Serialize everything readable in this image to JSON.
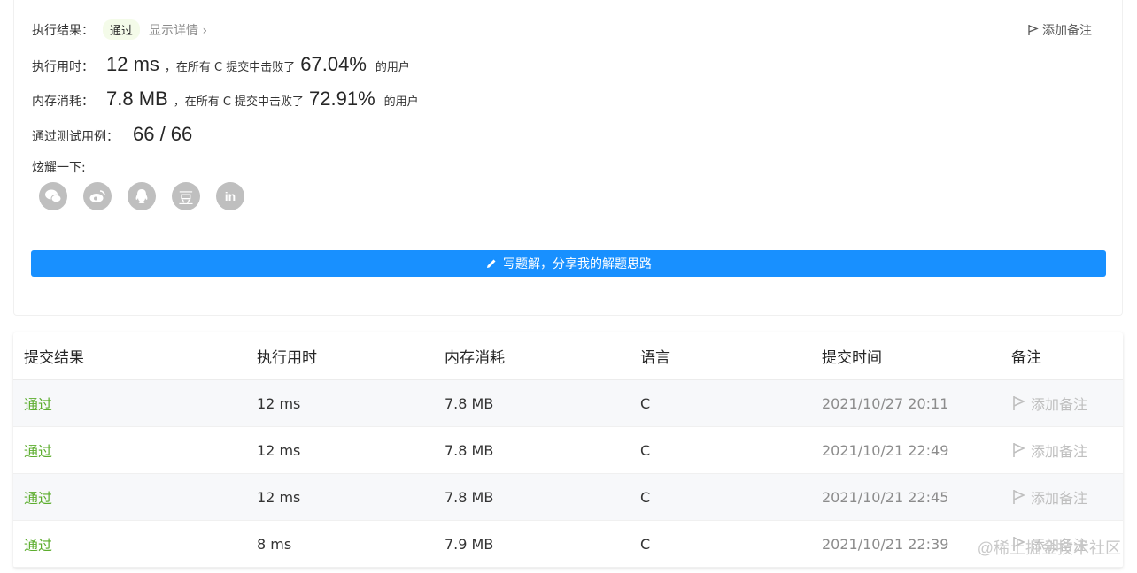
{
  "summary": {
    "result_label": "执行结果：",
    "result_value": "通过",
    "detail_link": "显示详情 ›",
    "add_note": "添加备注",
    "runtime_label": "执行用时：",
    "runtime_value": "12 ms",
    "runtime_mid": "，在所有 C 提交中击败了",
    "runtime_pct": "67.04%",
    "runtime_tail": "的用户",
    "memory_label": "内存消耗：",
    "memory_value": "7.8 MB",
    "memory_mid": "，在所有 C 提交中击败了",
    "memory_pct": "72.91%",
    "memory_tail": "的用户",
    "tests_label": "通过测试用例：",
    "tests_value": "66 / 66",
    "share_label": "炫耀一下:",
    "share_icons": [
      "wechat-icon",
      "weibo-icon",
      "qq-icon",
      "douban-icon",
      "linkedin-icon"
    ],
    "write_button": "写题解，分享我的解题思路"
  },
  "table": {
    "headers": [
      "提交结果",
      "执行用时",
      "内存消耗",
      "语言",
      "提交时间",
      "备注"
    ],
    "rows": [
      {
        "status": "通过",
        "runtime": "12 ms",
        "memory": "7.8 MB",
        "lang": "C",
        "time": "2021/10/27 20:11",
        "note": "添加备注"
      },
      {
        "status": "通过",
        "runtime": "12 ms",
        "memory": "7.8 MB",
        "lang": "C",
        "time": "2021/10/21 22:49",
        "note": "添加备注"
      },
      {
        "status": "通过",
        "runtime": "12 ms",
        "memory": "7.8 MB",
        "lang": "C",
        "time": "2021/10/21 22:45",
        "note": "添加备注"
      },
      {
        "status": "通过",
        "runtime": "8 ms",
        "memory": "7.9 MB",
        "lang": "C",
        "time": "2021/10/21 22:39",
        "note": "添加备注"
      }
    ]
  },
  "watermark": "@稀土掘金技术社区",
  "colors": {
    "accent": "#1890ff",
    "pass": "#5cad2e"
  }
}
